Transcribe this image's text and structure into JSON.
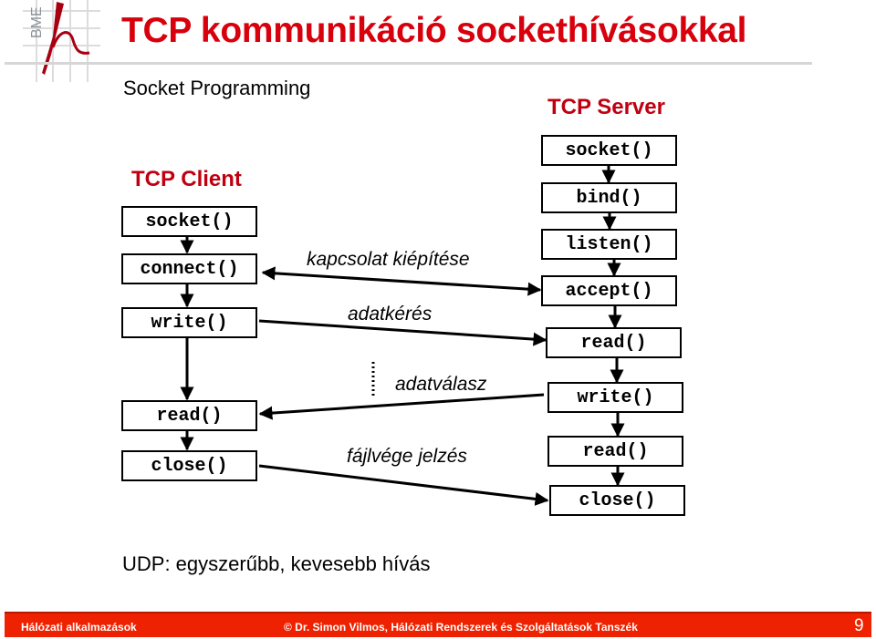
{
  "header": {
    "logo_text": "BME",
    "title": "TCP kommunikáció socket­hívásokkal",
    "subtitle": "Socket Programming"
  },
  "client": {
    "title": "TCP Client",
    "calls": [
      "socket()",
      "connect()",
      "write()",
      "read()",
      "close()"
    ]
  },
  "server": {
    "title": "TCP Server",
    "calls": [
      "socket()",
      "bind()",
      "listen()",
      "accept()",
      "read()",
      "write()",
      "read()",
      "close()"
    ]
  },
  "messages": {
    "connect": "kapcsolat kiépítése",
    "request": "adatkérés",
    "response": "adatválasz",
    "eof": "fájlvége jelzés"
  },
  "note": "UDP: egyszerűbb, kevesebb hívás",
  "footer": {
    "left": "Hálózati alkalmazások",
    "center": "© Dr. Simon Vilmos, Hálózati Rendszerek és Szolgáltatások Tanszék",
    "page": "9"
  },
  "colors": {
    "title_red": "#d8000c",
    "heading_red": "#c00010",
    "footer_red": "#ee2200",
    "logo_red": "#a80010"
  }
}
